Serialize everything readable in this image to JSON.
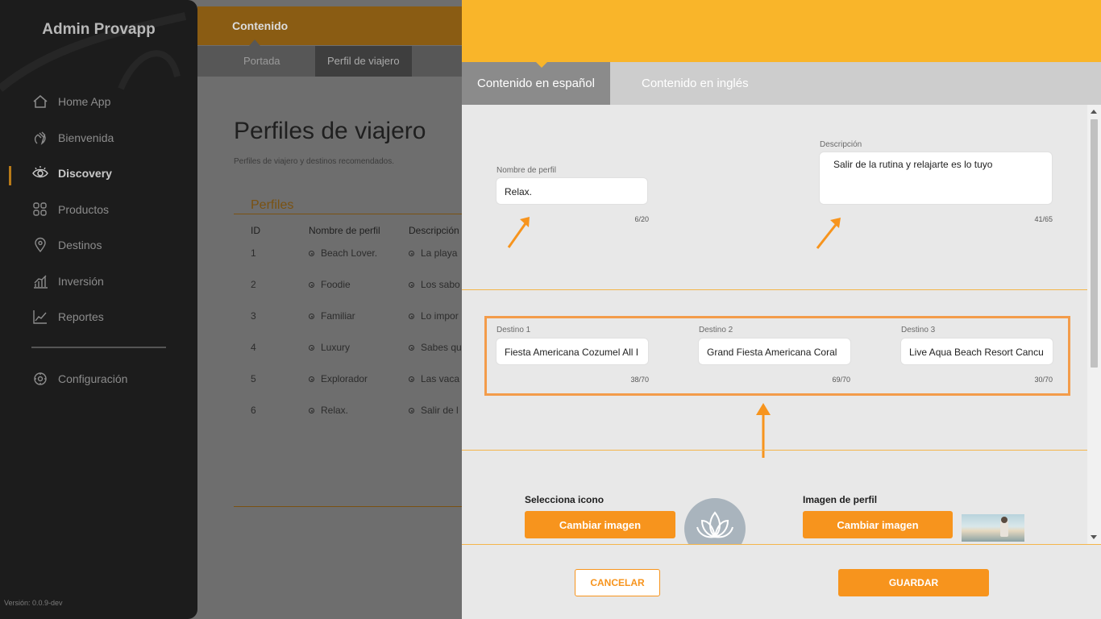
{
  "sidebar": {
    "title": "Admin Provapp",
    "items": [
      {
        "label": "Home App",
        "icon": "home-icon"
      },
      {
        "label": "Bienvenida",
        "icon": "hand-wave-icon"
      },
      {
        "label": "Discovery",
        "icon": "eye-icon",
        "active": true
      },
      {
        "label": "Productos",
        "icon": "grid-icon"
      },
      {
        "label": "Destinos",
        "icon": "map-pin-icon"
      },
      {
        "label": "Inversión",
        "icon": "bar-chart-icon"
      },
      {
        "label": "Reportes",
        "icon": "line-chart-icon"
      }
    ],
    "settings_label": "Configuración",
    "version": "Versión: 0.0.9-dev"
  },
  "background_page": {
    "header_title": "Contenido",
    "tabs": [
      "Portada",
      "Perfil de viajero"
    ],
    "page_title": "Perfiles de viajero",
    "page_subtitle": "Perfiles de viajero y destinos recomendados.",
    "section_title": "Perfiles",
    "columns": [
      "ID",
      "Nombre de perfil",
      "Descripción"
    ],
    "rows": [
      {
        "id": "1",
        "name": "Beach Lover.",
        "desc": "La playa"
      },
      {
        "id": "2",
        "name": "Foodie",
        "desc": "Los sabo"
      },
      {
        "id": "3",
        "name": "Familiar",
        "desc": "Lo impor"
      },
      {
        "id": "4",
        "name": "Luxury",
        "desc": "Sabes qu"
      },
      {
        "id": "5",
        "name": "Explorador",
        "desc": "Las vaca"
      },
      {
        "id": "6",
        "name": "Relax.",
        "desc": "Salir de l"
      }
    ]
  },
  "modal": {
    "tabs": [
      "Contenido en español",
      "Contenido en inglés"
    ],
    "profile_name": {
      "label": "Nombre de perfil",
      "value": "Relax.",
      "count": "6/20"
    },
    "description": {
      "label": "Descripción",
      "value": "Salir de la rutina y relajarte es lo tuyo",
      "count": "41/65"
    },
    "destinations": [
      {
        "label": "Destino 1",
        "value": "Fiesta Americana Cozumel All I",
        "count": "38/70"
      },
      {
        "label": "Destino 2",
        "value": "Grand Fiesta Americana Coral",
        "count": "69/70"
      },
      {
        "label": "Destino 3",
        "value": "Live Aqua Beach Resort Cancu",
        "count": "30/70"
      }
    ],
    "icon_section": {
      "title": "Selecciona icono",
      "button": "Cambiar imagen"
    },
    "image_section": {
      "title": "Imagen de perfil",
      "button": "Cambiar imagen"
    },
    "cancel_label": "CANCELAR",
    "save_label": "GUARDAR"
  },
  "colors": {
    "accent": "#f9b52a",
    "button": "#f7941d",
    "highlight_box": "#f39c4a",
    "sidebar_bg": "#1c1c1c"
  }
}
